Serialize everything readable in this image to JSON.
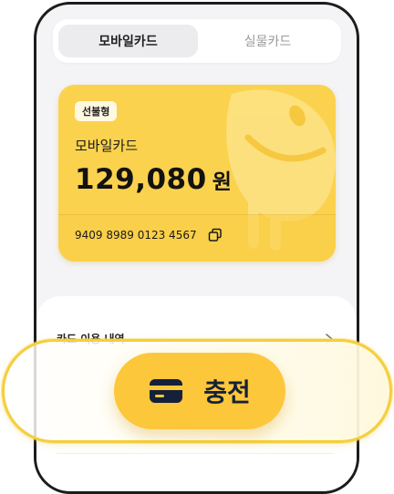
{
  "tabs": [
    {
      "label": "모바일카드",
      "active": true
    },
    {
      "label": "실물카드",
      "active": false
    }
  ],
  "card": {
    "badge": "선불형",
    "name": "모바일카드",
    "balance": "129,080",
    "currency": "원",
    "number": "9409 8989 0123 4567",
    "copy_icon": "copy-icon",
    "color": "#fbd24e"
  },
  "list": {
    "item_label": "카드 이용 내역",
    "chevron_icon": "chevron-right-icon"
  },
  "action": {
    "label": "충전",
    "icon": "card-icon",
    "color": "#fcc73a"
  }
}
